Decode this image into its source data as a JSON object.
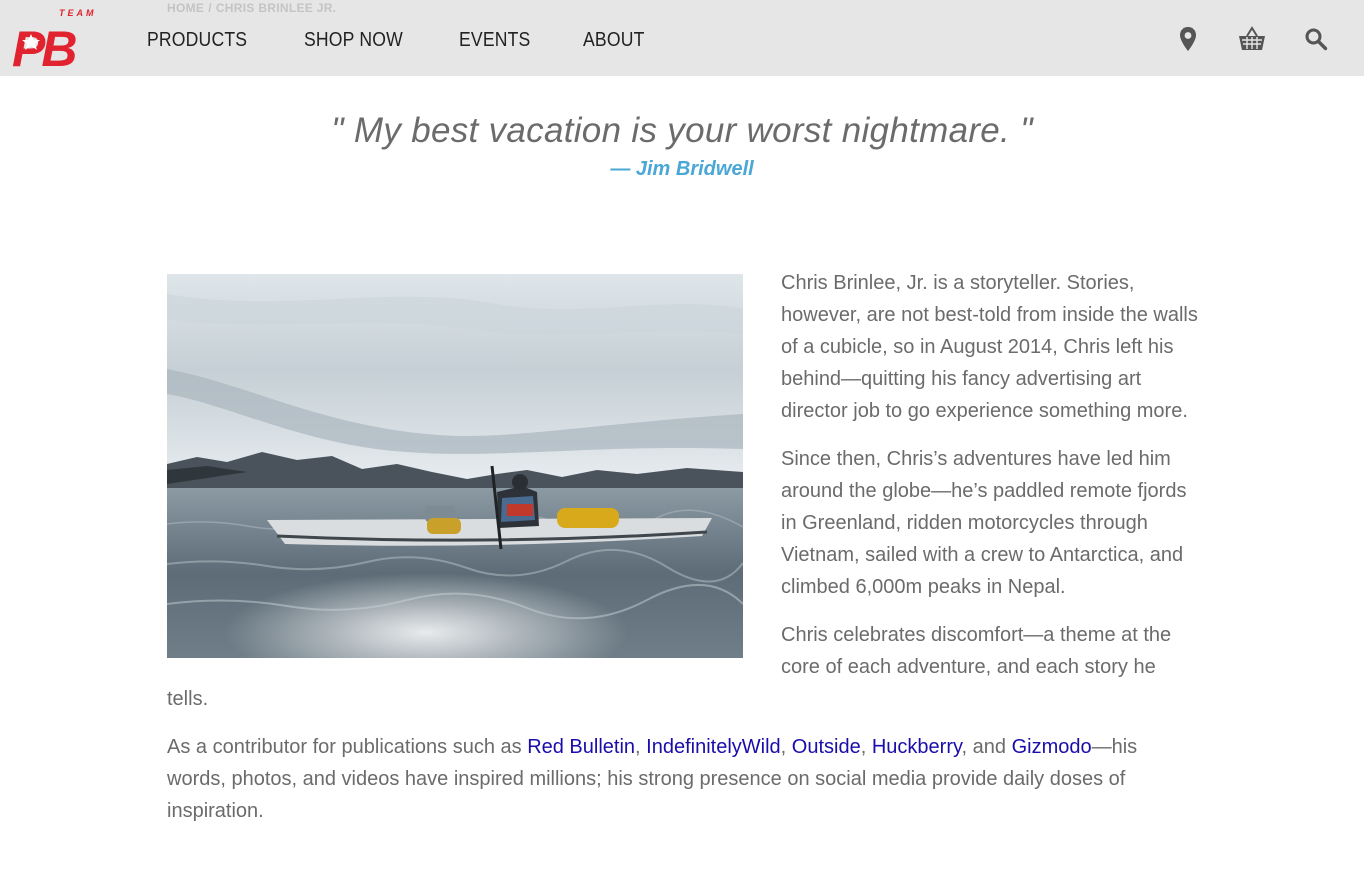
{
  "header": {
    "breadcrumb": {
      "home": "HOME",
      "separator": "/",
      "current": "CHRIS BRINLEE JR."
    },
    "logo": {
      "top_text": "TEAM",
      "mark_text": "PB",
      "color": "#e0232e"
    },
    "nav": [
      {
        "label": "PRODUCTS"
      },
      {
        "label": "SHOP NOW"
      },
      {
        "label": "EVENTS"
      },
      {
        "label": "ABOUT"
      }
    ],
    "icons": [
      "location-pin-icon",
      "shopping-basket-icon",
      "search-icon"
    ]
  },
  "quote": {
    "text": "\" My best vacation is your worst nightmare. \"",
    "attribution": "— Jim Bridwell",
    "attribution_color": "#4aa7d6"
  },
  "bio": {
    "p1": "Chris Brinlee, Jr. is a storyteller. Stories, however, are not best-told from inside the walls of a cubicle, so in August 2014, Chris left his behind—quitting his fancy advertising art director job to go experience something more.",
    "p2": "Since then, Chris’s adventures have led him around the globe—he’s paddled remote fjords in Greenland, ridden motorcycles through Vietnam, sailed with a crew to Antarctica, and climbed 6,000m peaks in Nepal.",
    "p3": "Chris celebrates discomfort—a theme at the core of each adventure, and each story he tells.",
    "p4": {
      "intro": "As a contributor for publications such as ",
      "links": [
        "Red Bulletin",
        "IndefinitelyWild",
        "Outside",
        "Huckberry",
        "Gizmodo"
      ],
      "sep1": ", ",
      "sep2": ", ",
      "sep3": ", ",
      "sep4": ", and ",
      "outro": "—his words, photos, and videos have inspired millions; his strong presence on social media provide daily doses of inspiration."
    },
    "link_color": "#1a0dab"
  }
}
